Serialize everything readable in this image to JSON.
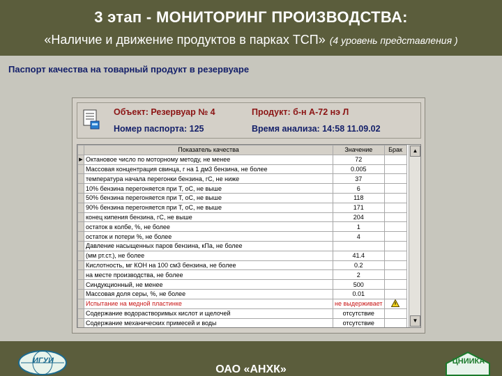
{
  "header": {
    "title": "3 этап - МОНИТОРИНГ ПРОИЗВОДСТВА:",
    "subtitle": "«Наличие и движение продуктов в парках ТСП»",
    "subtitle_note": "(4 уровень представления )"
  },
  "page_caption": "Паспорт качества на товарный продукт в резервуаре",
  "info": {
    "object_label": "Объект: Резервуар № 4",
    "product_label": "Продукт: б-н А-72 нэ Л",
    "passport_label": "Номер паспорта: 125",
    "time_label": "Время анализа: 14:58 11.09.02"
  },
  "grid": {
    "columns": [
      "Показатель качества",
      "Значение",
      "Брак"
    ],
    "rows": [
      {
        "name": "Октановое число по моторному методу, не менее",
        "value": "72",
        "warn": false
      },
      {
        "name": "Массовая концентрация свинца, г на 1 дм3 бензина, не более",
        "value": "0.005",
        "warn": false
      },
      {
        "name": "температура начала перегонки бензина, гС, не ниже",
        "value": "37",
        "warn": false
      },
      {
        "name": "10% бензина перегоняется при Т, оС, не выше",
        "value": "6",
        "warn": false
      },
      {
        "name": "50% бензина перегоняется при Т, оС, не выше",
        "value": "118",
        "warn": false
      },
      {
        "name": "90% бензина перегоняется при Т, оС, не выше",
        "value": "171",
        "warn": false
      },
      {
        "name": "конец кипения бензина, гС, не выше",
        "value": "204",
        "warn": false
      },
      {
        "name": "остаток в колбе, %, не более",
        "value": "1",
        "warn": false
      },
      {
        "name": "остаток и потери %, не более",
        "value": "4",
        "warn": false
      },
      {
        "name": "Давление насыщенных паров бензина, кПа, не более",
        "value": "",
        "warn": false
      },
      {
        "name": "(мм рт.ст.), не более",
        "value": "41.4",
        "warn": false
      },
      {
        "name": "Кислотность, мг КОН на 100 см3 бензина, не более",
        "value": "0.2",
        "warn": false
      },
      {
        "name": "на месте производства, не более",
        "value": "2",
        "warn": false
      },
      {
        "name": "Синдукционный, не менее",
        "value": "500",
        "warn": false
      },
      {
        "name": "Массовая доля серы, %, не более",
        "value": "0.01",
        "warn": false
      },
      {
        "name": "Испытание на медной пластинке",
        "value": "не выдерживает",
        "warn": true
      },
      {
        "name": "Содержание водорастворимых кислот и щелочей",
        "value": "отсутствие",
        "warn": false
      },
      {
        "name": "Содержание механических примесей и воды",
        "value": "отсутствие",
        "warn": false
      }
    ]
  },
  "footer": {
    "company": "ОАО «АНХК»",
    "logo_left_text": "ИГУИ",
    "logo_right_text": "ЦНИИКА"
  },
  "colors": {
    "header_bg": "#5b5d3c",
    "label_dark_red": "#8b1414",
    "label_blue": "#14206a",
    "warn_red": "#c81414"
  },
  "icons": [
    "document-icon",
    "warning-icon",
    "scroll-up-icon",
    "scroll-down-icon",
    "row-pointer-icon"
  ]
}
